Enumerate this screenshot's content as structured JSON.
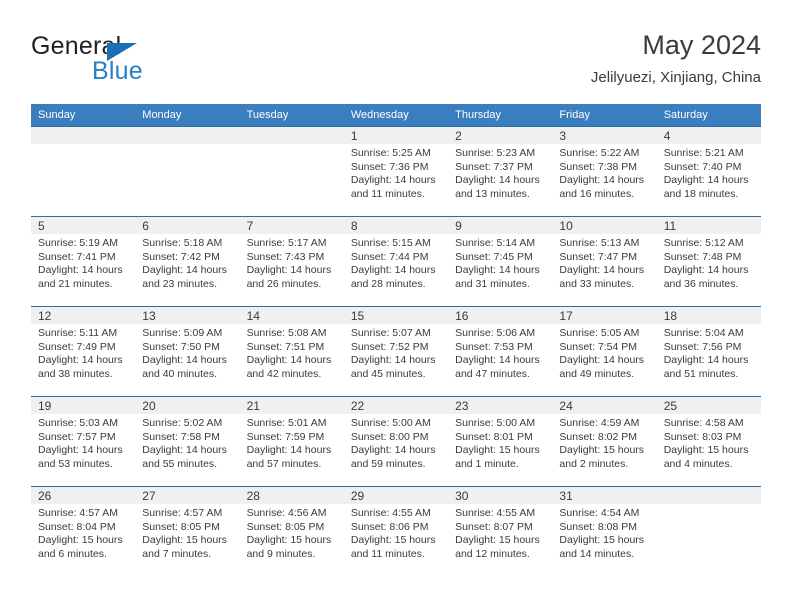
{
  "brand": {
    "name_part1": "General",
    "name_part2": "Blue",
    "accent_color": "#2a7fc4",
    "triangle_color": "#1c6fb5"
  },
  "header": {
    "title": "May 2024",
    "subtitle": "Jelilyuezi, Xinjiang, China"
  },
  "theme": {
    "header_row_bg": "#3a7ebf",
    "daynum_band_bg": "#f0f0f0",
    "row_border": "#2d6da3",
    "text": "#3b3b3b"
  },
  "weekday_headers": [
    "Sunday",
    "Monday",
    "Tuesday",
    "Wednesday",
    "Thursday",
    "Friday",
    "Saturday"
  ],
  "labels": {
    "sunrise_prefix": "Sunrise: ",
    "sunset_prefix": "Sunset: ",
    "daylight_prefix": "Daylight: "
  },
  "weeks": [
    [
      {
        "day": "",
        "empty": true
      },
      {
        "day": "",
        "empty": true
      },
      {
        "day": "",
        "empty": true
      },
      {
        "day": "1",
        "sunrise": "Sunrise: 5:25 AM",
        "sunset": "Sunset: 7:36 PM",
        "daylight_line1": "Daylight: 14 hours",
        "daylight_line2": "and 11 minutes."
      },
      {
        "day": "2",
        "sunrise": "Sunrise: 5:23 AM",
        "sunset": "Sunset: 7:37 PM",
        "daylight_line1": "Daylight: 14 hours",
        "daylight_line2": "and 13 minutes."
      },
      {
        "day": "3",
        "sunrise": "Sunrise: 5:22 AM",
        "sunset": "Sunset: 7:38 PM",
        "daylight_line1": "Daylight: 14 hours",
        "daylight_line2": "and 16 minutes."
      },
      {
        "day": "4",
        "sunrise": "Sunrise: 5:21 AM",
        "sunset": "Sunset: 7:40 PM",
        "daylight_line1": "Daylight: 14 hours",
        "daylight_line2": "and 18 minutes."
      }
    ],
    [
      {
        "day": "5",
        "sunrise": "Sunrise: 5:19 AM",
        "sunset": "Sunset: 7:41 PM",
        "daylight_line1": "Daylight: 14 hours",
        "daylight_line2": "and 21 minutes."
      },
      {
        "day": "6",
        "sunrise": "Sunrise: 5:18 AM",
        "sunset": "Sunset: 7:42 PM",
        "daylight_line1": "Daylight: 14 hours",
        "daylight_line2": "and 23 minutes."
      },
      {
        "day": "7",
        "sunrise": "Sunrise: 5:17 AM",
        "sunset": "Sunset: 7:43 PM",
        "daylight_line1": "Daylight: 14 hours",
        "daylight_line2": "and 26 minutes."
      },
      {
        "day": "8",
        "sunrise": "Sunrise: 5:15 AM",
        "sunset": "Sunset: 7:44 PM",
        "daylight_line1": "Daylight: 14 hours",
        "daylight_line2": "and 28 minutes."
      },
      {
        "day": "9",
        "sunrise": "Sunrise: 5:14 AM",
        "sunset": "Sunset: 7:45 PM",
        "daylight_line1": "Daylight: 14 hours",
        "daylight_line2": "and 31 minutes."
      },
      {
        "day": "10",
        "sunrise": "Sunrise: 5:13 AM",
        "sunset": "Sunset: 7:47 PM",
        "daylight_line1": "Daylight: 14 hours",
        "daylight_line2": "and 33 minutes."
      },
      {
        "day": "11",
        "sunrise": "Sunrise: 5:12 AM",
        "sunset": "Sunset: 7:48 PM",
        "daylight_line1": "Daylight: 14 hours",
        "daylight_line2": "and 36 minutes."
      }
    ],
    [
      {
        "day": "12",
        "sunrise": "Sunrise: 5:11 AM",
        "sunset": "Sunset: 7:49 PM",
        "daylight_line1": "Daylight: 14 hours",
        "daylight_line2": "and 38 minutes."
      },
      {
        "day": "13",
        "sunrise": "Sunrise: 5:09 AM",
        "sunset": "Sunset: 7:50 PM",
        "daylight_line1": "Daylight: 14 hours",
        "daylight_line2": "and 40 minutes."
      },
      {
        "day": "14",
        "sunrise": "Sunrise: 5:08 AM",
        "sunset": "Sunset: 7:51 PM",
        "daylight_line1": "Daylight: 14 hours",
        "daylight_line2": "and 42 minutes."
      },
      {
        "day": "15",
        "sunrise": "Sunrise: 5:07 AM",
        "sunset": "Sunset: 7:52 PM",
        "daylight_line1": "Daylight: 14 hours",
        "daylight_line2": "and 45 minutes."
      },
      {
        "day": "16",
        "sunrise": "Sunrise: 5:06 AM",
        "sunset": "Sunset: 7:53 PM",
        "daylight_line1": "Daylight: 14 hours",
        "daylight_line2": "and 47 minutes."
      },
      {
        "day": "17",
        "sunrise": "Sunrise: 5:05 AM",
        "sunset": "Sunset: 7:54 PM",
        "daylight_line1": "Daylight: 14 hours",
        "daylight_line2": "and 49 minutes."
      },
      {
        "day": "18",
        "sunrise": "Sunrise: 5:04 AM",
        "sunset": "Sunset: 7:56 PM",
        "daylight_line1": "Daylight: 14 hours",
        "daylight_line2": "and 51 minutes."
      }
    ],
    [
      {
        "day": "19",
        "sunrise": "Sunrise: 5:03 AM",
        "sunset": "Sunset: 7:57 PM",
        "daylight_line1": "Daylight: 14 hours",
        "daylight_line2": "and 53 minutes."
      },
      {
        "day": "20",
        "sunrise": "Sunrise: 5:02 AM",
        "sunset": "Sunset: 7:58 PM",
        "daylight_line1": "Daylight: 14 hours",
        "daylight_line2": "and 55 minutes."
      },
      {
        "day": "21",
        "sunrise": "Sunrise: 5:01 AM",
        "sunset": "Sunset: 7:59 PM",
        "daylight_line1": "Daylight: 14 hours",
        "daylight_line2": "and 57 minutes."
      },
      {
        "day": "22",
        "sunrise": "Sunrise: 5:00 AM",
        "sunset": "Sunset: 8:00 PM",
        "daylight_line1": "Daylight: 14 hours",
        "daylight_line2": "and 59 minutes."
      },
      {
        "day": "23",
        "sunrise": "Sunrise: 5:00 AM",
        "sunset": "Sunset: 8:01 PM",
        "daylight_line1": "Daylight: 15 hours",
        "daylight_line2": "and 1 minute."
      },
      {
        "day": "24",
        "sunrise": "Sunrise: 4:59 AM",
        "sunset": "Sunset: 8:02 PM",
        "daylight_line1": "Daylight: 15 hours",
        "daylight_line2": "and 2 minutes."
      },
      {
        "day": "25",
        "sunrise": "Sunrise: 4:58 AM",
        "sunset": "Sunset: 8:03 PM",
        "daylight_line1": "Daylight: 15 hours",
        "daylight_line2": "and 4 minutes."
      }
    ],
    [
      {
        "day": "26",
        "sunrise": "Sunrise: 4:57 AM",
        "sunset": "Sunset: 8:04 PM",
        "daylight_line1": "Daylight: 15 hours",
        "daylight_line2": "and 6 minutes."
      },
      {
        "day": "27",
        "sunrise": "Sunrise: 4:57 AM",
        "sunset": "Sunset: 8:05 PM",
        "daylight_line1": "Daylight: 15 hours",
        "daylight_line2": "and 7 minutes."
      },
      {
        "day": "28",
        "sunrise": "Sunrise: 4:56 AM",
        "sunset": "Sunset: 8:05 PM",
        "daylight_line1": "Daylight: 15 hours",
        "daylight_line2": "and 9 minutes."
      },
      {
        "day": "29",
        "sunrise": "Sunrise: 4:55 AM",
        "sunset": "Sunset: 8:06 PM",
        "daylight_line1": "Daylight: 15 hours",
        "daylight_line2": "and 11 minutes."
      },
      {
        "day": "30",
        "sunrise": "Sunrise: 4:55 AM",
        "sunset": "Sunset: 8:07 PM",
        "daylight_line1": "Daylight: 15 hours",
        "daylight_line2": "and 12 minutes."
      },
      {
        "day": "31",
        "sunrise": "Sunrise: 4:54 AM",
        "sunset": "Sunset: 8:08 PM",
        "daylight_line1": "Daylight: 15 hours",
        "daylight_line2": "and 14 minutes."
      },
      {
        "day": "",
        "empty": true
      }
    ]
  ]
}
